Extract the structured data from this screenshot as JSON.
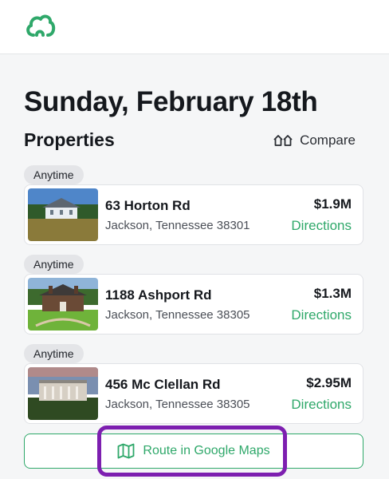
{
  "header": {
    "logo_icon": "cloud-logo-icon"
  },
  "page": {
    "date_title": "Sunday, February 18th"
  },
  "properties": {
    "title": "Properties",
    "compare_label": "Compare",
    "items": [
      {
        "time_badge": "Anytime",
        "address": "63 Horton Rd",
        "city": "Jackson, Tennessee 38301",
        "price": "$1.9M",
        "directions": "Directions"
      },
      {
        "time_badge": "Anytime",
        "address": "1188 Ashport Rd",
        "city": "Jackson, Tennessee 38305",
        "price": "$1.3M",
        "directions": "Directions"
      },
      {
        "time_badge": "Anytime",
        "address": "456 Mc Clellan Rd",
        "city": "Jackson, Tennessee 38305",
        "price": "$2.95M",
        "directions": "Directions"
      }
    ]
  },
  "route": {
    "label": "Route in Google Maps"
  },
  "colors": {
    "accent": "#2fa86a",
    "highlight": "#7d1fb0"
  }
}
